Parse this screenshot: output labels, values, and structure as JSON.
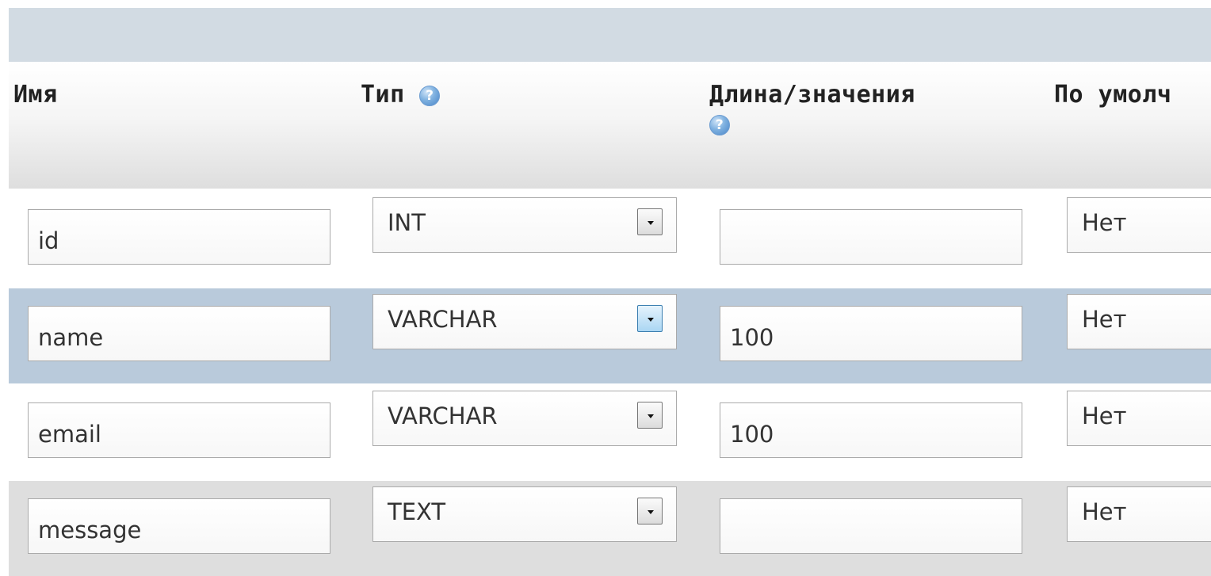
{
  "table": {
    "headers": {
      "name": "Имя",
      "type": "Тип",
      "length": "Длина/значения",
      "default": "По умолч"
    },
    "rows": [
      {
        "name": "id",
        "type": "INT",
        "length": "",
        "default": "Нет"
      },
      {
        "name": "name",
        "type": "VARCHAR",
        "length": "100",
        "default": "Нет"
      },
      {
        "name": "email",
        "type": "VARCHAR",
        "length": "100",
        "default": "Нет"
      },
      {
        "name": "message",
        "type": "TEXT",
        "length": "",
        "default": "Нет"
      }
    ]
  },
  "help_icon": "question-mark-circle-icon",
  "colors": {
    "top_bar": "#d2dbe3",
    "highlight_row": "#b9cadb",
    "alt_row": "#dedede"
  }
}
